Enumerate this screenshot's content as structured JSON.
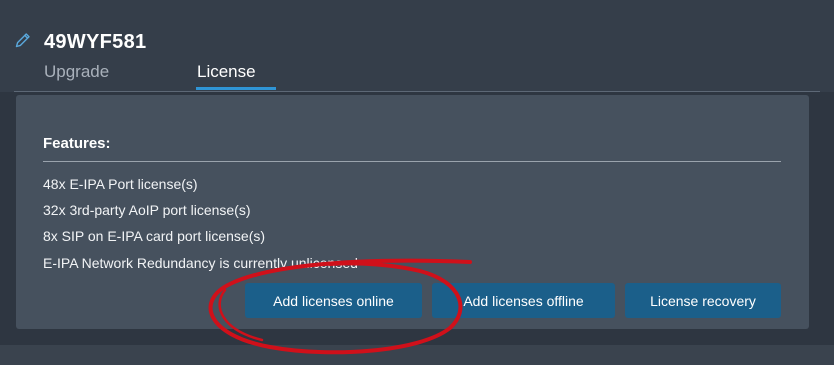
{
  "device": {
    "name": "49WYF581",
    "edit_icon": "pencil-icon"
  },
  "tabs": [
    {
      "label": "Upgrade",
      "active": false
    },
    {
      "label": "License",
      "active": true
    }
  ],
  "features": {
    "title": "Features:",
    "items": [
      "48x E-IPA Port license(s)",
      "32x 3rd-party AoIP port license(s)",
      "8x SIP on E-IPA card port license(s)",
      "E-IPA Network Redundancy is currently unlicensed"
    ]
  },
  "buttons": {
    "add_online": "Add licenses online",
    "add_offline": "Add licenses offline",
    "recovery": "License recovery"
  },
  "colors": {
    "accent": "#2f95d6",
    "button": "#1b5f8a",
    "annotation": "#d0101a"
  }
}
